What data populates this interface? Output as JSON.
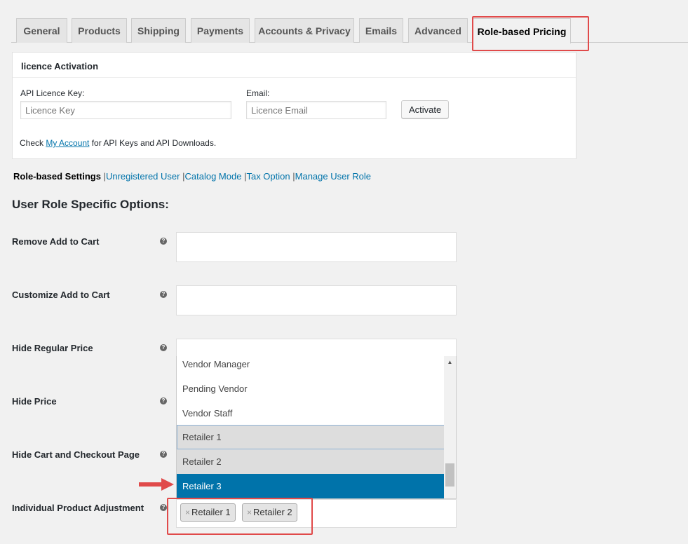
{
  "tabs": [
    {
      "label": "General",
      "active": false
    },
    {
      "label": "Products",
      "active": false
    },
    {
      "label": "Shipping",
      "active": false
    },
    {
      "label": "Payments",
      "active": false
    },
    {
      "label": "Accounts & Privacy",
      "active": false
    },
    {
      "label": "Emails",
      "active": false
    },
    {
      "label": "Advanced",
      "active": false
    },
    {
      "label": "Role-based Pricing",
      "active": true
    }
  ],
  "licence": {
    "title": "licence Activation",
    "api_key_label": "API Licence Key:",
    "api_key_placeholder": "Licence Key",
    "api_key_value": "",
    "email_label": "Email:",
    "email_placeholder": "Licence Email",
    "email_value": "",
    "activate_label": "Activate",
    "note_prefix": "Check ",
    "note_link": "My Account",
    "note_suffix": " for API Keys and API Downloads."
  },
  "subnav": {
    "current": "Role-based Settings",
    "separator": "|",
    "links": [
      "Unregistered User",
      "Catalog Mode",
      "Tax Option",
      "Manage User Role"
    ]
  },
  "section_title": "User Role Specific Options:",
  "help_glyph": "?",
  "rows": [
    {
      "label": "Remove Add to Cart"
    },
    {
      "label": "Customize Add to Cart"
    },
    {
      "label": "Hide Regular Price"
    },
    {
      "label": "Hide Price"
    },
    {
      "label": "Hide Cart and Checkout Page"
    },
    {
      "label": "Individual Product Adjustment"
    }
  ],
  "dropdown": {
    "options": [
      {
        "label": "Vendor Manager",
        "state": "normal"
      },
      {
        "label": "Pending Vendor",
        "state": "normal"
      },
      {
        "label": "Vendor Staff",
        "state": "normal"
      },
      {
        "label": "Retailer 1",
        "state": "selected"
      },
      {
        "label": "Retailer 2",
        "state": "selected"
      },
      {
        "label": "Retailer 3",
        "state": "highlighted"
      }
    ],
    "scroll_up_glyph": "▲"
  },
  "selected_tags": [
    {
      "label": "Retailer 1",
      "remove": "×"
    },
    {
      "label": "Retailer 2",
      "remove": "×"
    }
  ],
  "colors": {
    "accent": "#0073aa",
    "annotation": "#e04a4a",
    "selected_option": "#dddddd"
  }
}
